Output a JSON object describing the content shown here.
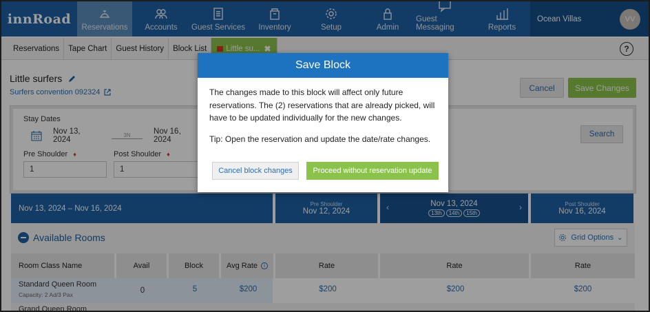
{
  "brand": {
    "logo": "innRoad"
  },
  "nav": {
    "items": [
      {
        "label": "Reservations",
        "icon": "bell-icon",
        "active": true
      },
      {
        "label": "Accounts",
        "icon": "users-icon"
      },
      {
        "label": "Guest Services",
        "icon": "clipboard-icon"
      },
      {
        "label": "Inventory",
        "icon": "box-icon"
      },
      {
        "label": "Setup",
        "icon": "gear-icon"
      },
      {
        "label": "Admin",
        "icon": "lock-icon"
      },
      {
        "label": "Guest Messaging",
        "icon": "chat-icon"
      },
      {
        "label": "Reports",
        "icon": "bar-chart-icon"
      }
    ],
    "property": "Ocean Villas",
    "avatar_initials": "VV"
  },
  "subtabs": {
    "items": [
      "Reservations",
      "Tape Chart",
      "Guest History",
      "Block List"
    ],
    "active_tab": "Little su...",
    "close_glyph": "✖",
    "help": "?"
  },
  "block": {
    "title": "Little surfers",
    "subtitle": "Surfers convention 092324",
    "cancel_label": "Cancel",
    "save_label": "Save Changes"
  },
  "stay": {
    "stay_dates_label": "Stay Dates",
    "arrival": "Nov 13, 2024",
    "nights": "3N",
    "departure": "Nov 16, 2024",
    "pre_shoulder_label": "Pre Shoulder",
    "post_shoulder_label": "Post Shoulder",
    "pre_shoulder_value": "1",
    "post_shoulder_value": "1",
    "search_label": "Search"
  },
  "date_strip": {
    "range": "Nov 13, 2024 – Nov 16, 2024",
    "pre_label": "Pre Shoulder",
    "pre_date": "Nov 12, 2024",
    "mid_date": "Nov 13, 2024",
    "mid_days": [
      "13th",
      "14th",
      "15th"
    ],
    "post_label": "Post Shoulder",
    "post_date": "Nov 16, 2024"
  },
  "rooms": {
    "title": "Available Rooms",
    "grid_options": "Grid Options",
    "headers": [
      "Room Class Name",
      "Avail",
      "Block",
      "Avg Rate",
      "Rate",
      "Rate",
      "Rate"
    ],
    "rows": [
      {
        "name": "Standard Queen Room",
        "capacity": "Capacity: 2 Ad/3 Pax",
        "avail": "0",
        "block": "5",
        "avg_rate": "$200",
        "rates": [
          "$200",
          "$200",
          "$200"
        ]
      },
      {
        "name": "Grand Queen Room"
      }
    ]
  },
  "modal": {
    "title": "Save Block",
    "body": "The changes made to this block will affect only future reservations. The (2) reservations that are already picked, will have to be updated individually for the new changes.",
    "tip": "Tip: Open the reservation and update the date/rate changes.",
    "cancel_label": "Cancel block changes",
    "proceed_label": "Proceed without reservation update"
  }
}
